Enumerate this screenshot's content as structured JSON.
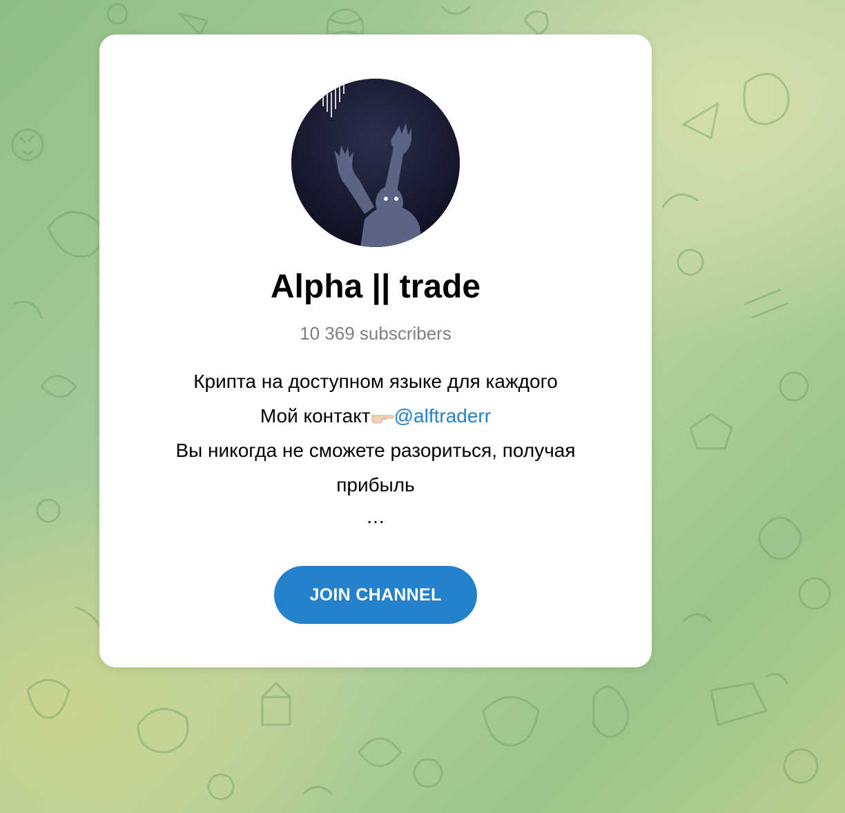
{
  "channel": {
    "title": "Alpha || trade",
    "subscribers": "10 369 subscribers",
    "description": {
      "line1": "Крипта на доступном языке для каждого",
      "line2_prefix": "Мой контакт",
      "line2_emoji": "pointing-right-hand-emoji",
      "line2_link": "@alftraderr",
      "line3": "Вы никогда не сможете разориться, получая прибыль",
      "line4": "…"
    }
  },
  "join_button": {
    "label": "JOIN CHANNEL"
  },
  "colors": {
    "accent": "#2481cc",
    "background": "#a7c99a",
    "card": "#ffffff",
    "subtle_text": "#7d7f82"
  }
}
